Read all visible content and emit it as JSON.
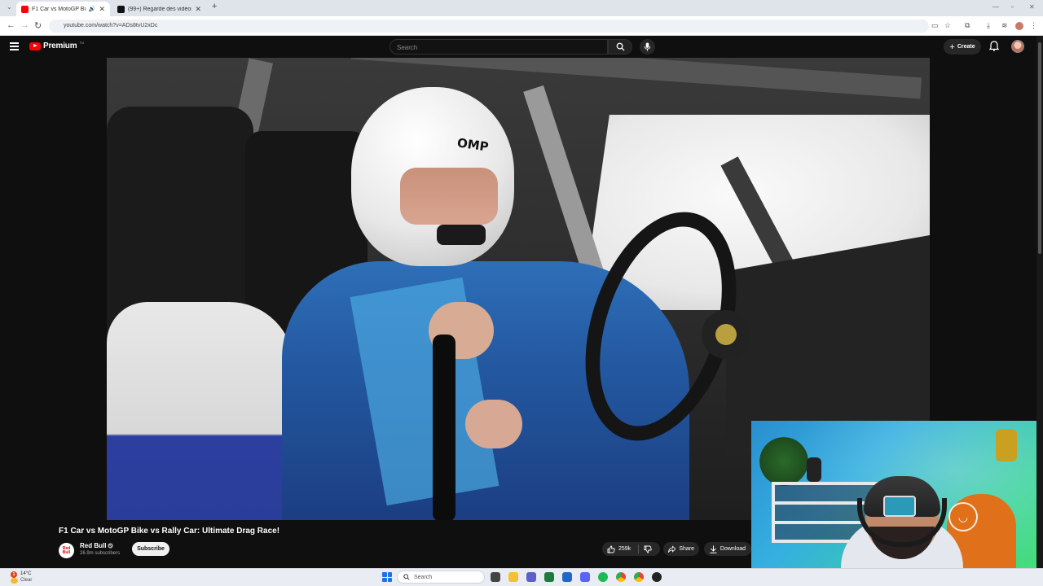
{
  "browser": {
    "tabs": [
      {
        "label": "F1 Car vs MotoGP Bike vs R",
        "active": true
      },
      {
        "label": "(99+) Regarde des vidéos tend",
        "active": false
      }
    ],
    "url": "youtube.com/watch?v=ADs8tvU2xDc"
  },
  "header": {
    "logo_text": "Premium",
    "logo_sup": "TN",
    "search_placeholder": "Search",
    "create_label": "Create"
  },
  "video": {
    "title": "F1 Car vs MotoGP Bike vs Rally Car: Ultimate Drag Race!",
    "helmet_brand": "OMP",
    "channel": {
      "name": "Red Bull",
      "avatar_text": "Red Bull",
      "subscribers": "26.9m subscribers",
      "verified": true
    },
    "subscribe_label": "Subscribe",
    "likes": "259k",
    "share_label": "Share",
    "download_label": "Download"
  },
  "taskbar": {
    "weather_badge": "1",
    "temperature": "14°C",
    "condition": "Clear",
    "search_label": "Search"
  },
  "colors": {
    "yt_red": "#ff0000",
    "background": "#0f0f0f",
    "pill": "#272727",
    "subscribe_bg": "#f1f1f1"
  }
}
